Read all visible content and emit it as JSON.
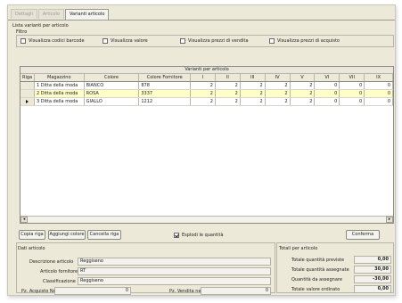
{
  "tabs": [
    {
      "label": "Dettagli"
    },
    {
      "label": "Articolo"
    },
    {
      "label": "Varianti articolo"
    }
  ],
  "list_label": "Lista varianti per articolo",
  "filter": {
    "label": "Filtro",
    "options": [
      {
        "label": "Visualizza codici barcode",
        "checked": false
      },
      {
        "label": "Visualizza valore",
        "checked": false
      },
      {
        "label": "Visualizza prezzi di vendita",
        "checked": false
      },
      {
        "label": "Visualizza prezzi di acquisto",
        "checked": false
      }
    ]
  },
  "grid": {
    "title": "Varianti per articolo",
    "columns": [
      "Riga",
      "Magazzino",
      "Colore",
      "Colore Fornitore",
      "I",
      "II",
      "III",
      "IV",
      "V",
      "VI",
      "VII",
      "IX"
    ],
    "rows": [
      {
        "riga": "",
        "magazzino": "1 Ditta della moda",
        "colore": "BIANCO",
        "fornitore": "878",
        "values": [
          "2",
          "2",
          "2",
          "2",
          "2",
          "0",
          "0",
          "0"
        ]
      },
      {
        "riga": "",
        "magazzino": "2 Ditta della moda",
        "colore": "ROSA",
        "fornitore": "3337",
        "values": [
          "2",
          "2",
          "2",
          "2",
          "2",
          "0",
          "0",
          "0"
        ]
      },
      {
        "riga": "",
        "magazzino": "3 Ditta della moda",
        "colore": "GIALLO",
        "fornitore": "1212",
        "values": [
          "2",
          "2",
          "2",
          "2",
          "2",
          "0",
          "0",
          "0"
        ]
      }
    ],
    "selected_row": 1,
    "current_row": 2
  },
  "buttons": {
    "copia": "Copia riga",
    "aggiungi": "Aggiungi colore",
    "cancella": "Cancella riga",
    "esplodi": "Esplodi le quantità",
    "conferma": "Conferma"
  },
  "dati": {
    "label": "Dati articolo",
    "descrizione_label": "Descrizione articolo",
    "descrizione": "Reggiseno",
    "fornitore_label": "Articolo fornitore",
    "fornitore": "RT",
    "classificazione_label": "Classificazione",
    "classificazione": "Reggiseno",
    "acquisto_label": "Pz. Acquisto Netto",
    "acquisto": "0",
    "vendita_label": "Pz. Vendita netto",
    "vendita": "0"
  },
  "totali": {
    "label": "Totali per articolo",
    "rows": [
      {
        "label": "Totale quantità previste",
        "value": "0,00"
      },
      {
        "label": "Totale quantità assegnate",
        "value": "30,00"
      },
      {
        "label": "Quantità da assegnare",
        "value": "-30,00"
      },
      {
        "label": "Totale valore ordinato",
        "value": "0,00"
      }
    ]
  },
  "colors": {
    "selected_row": "#ffffc8",
    "window_bg": "#ece9d8"
  }
}
